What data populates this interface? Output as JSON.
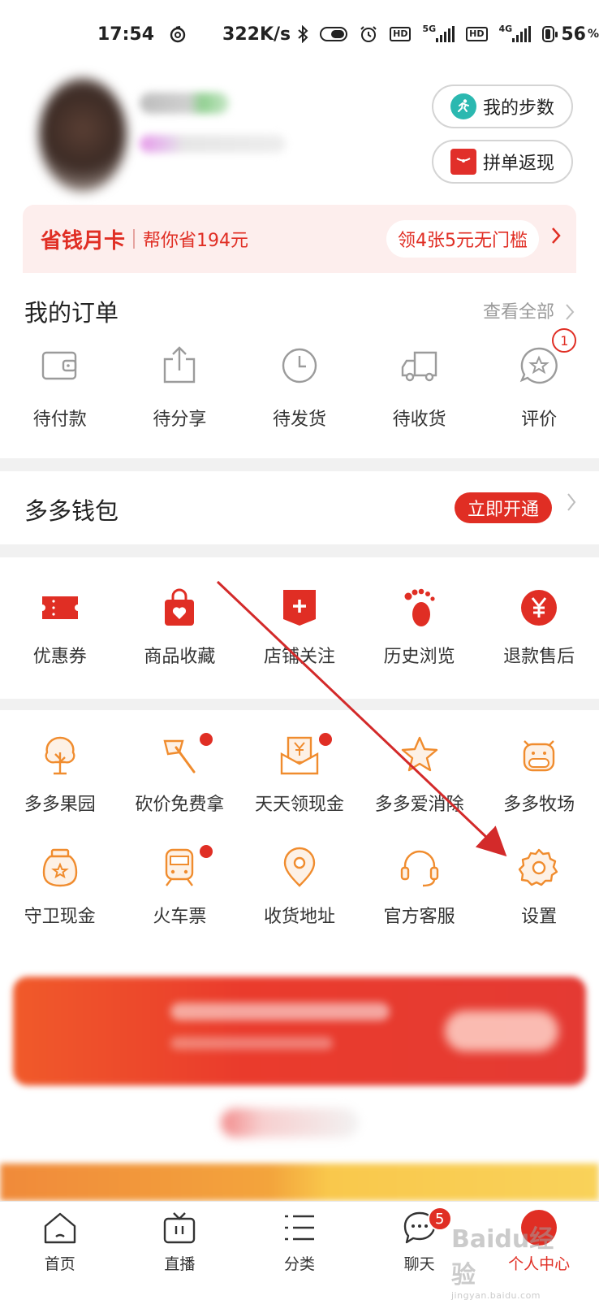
{
  "status_bar": {
    "time": "17:54",
    "network_speed": "322K/s",
    "battery": "56",
    "battery_unit": "%",
    "hd1": "HD",
    "hd2": "HD",
    "net1": "5G",
    "net2": "4G"
  },
  "header": {
    "steps_button": "我的步数",
    "group_buy_button": "拼单返现",
    "card": {
      "title": "省钱月卡",
      "savings": "帮你省194元",
      "coupon": "领4张5元无门槛"
    }
  },
  "orders": {
    "title": "我的订单",
    "view_all": "查看全部",
    "items": [
      {
        "label": "待付款",
        "icon": "wallet-icon"
      },
      {
        "label": "待分享",
        "icon": "share-icon"
      },
      {
        "label": "待发货",
        "icon": "clock-icon"
      },
      {
        "label": "待收货",
        "icon": "truck-icon"
      },
      {
        "label": "评价",
        "icon": "review-icon",
        "badge": "1"
      }
    ]
  },
  "wallet": {
    "title": "多多钱包",
    "open_button": "立即开通"
  },
  "shortcuts": [
    {
      "label": "优惠券",
      "icon": "coupon-icon"
    },
    {
      "label": "商品收藏",
      "icon": "bag-heart-icon"
    },
    {
      "label": "店铺关注",
      "icon": "store-plus-icon"
    },
    {
      "label": "历史浏览",
      "icon": "footprint-icon"
    },
    {
      "label": "退款售后",
      "icon": "yen-icon"
    }
  ],
  "services": {
    "row1": [
      {
        "label": "多多果园",
        "icon": "tree-icon"
      },
      {
        "label": "砍价免费拿",
        "icon": "axe-icon",
        "dot": true
      },
      {
        "label": "天天领现金",
        "icon": "cash-envelope-icon",
        "dot": true
      },
      {
        "label": "多多爱消除",
        "icon": "star-icon"
      },
      {
        "label": "多多牧场",
        "icon": "cow-icon"
      }
    ],
    "row2": [
      {
        "label": "守卫现金",
        "icon": "jar-icon"
      },
      {
        "label": "火车票",
        "icon": "train-icon",
        "dot": true
      },
      {
        "label": "收货地址",
        "icon": "location-icon"
      },
      {
        "label": "官方客服",
        "icon": "headset-icon"
      },
      {
        "label": "设置",
        "icon": "gear-icon"
      }
    ]
  },
  "tabbar": [
    {
      "label": "首页",
      "icon": "home-icon"
    },
    {
      "label": "直播",
      "icon": "tv-icon"
    },
    {
      "label": "分类",
      "icon": "list-icon"
    },
    {
      "label": "聊天",
      "icon": "chat-icon",
      "badge": "5"
    },
    {
      "label": "个人中心",
      "icon": "profile-icon",
      "active": true
    }
  ],
  "watermark": {
    "text": "Baidu经验",
    "sub": "jingyan.baidu.com"
  },
  "colors": {
    "accent": "#e02e24",
    "service_orange": "#f08c2e",
    "order_gray": "#9b9b9b"
  }
}
